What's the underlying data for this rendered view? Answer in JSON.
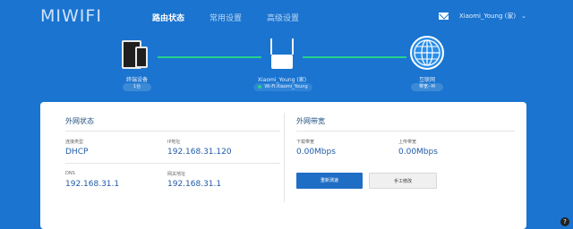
{
  "app": {
    "logo": "MIWIFI"
  },
  "nav": {
    "items": [
      {
        "label": "路由状态",
        "active": true
      },
      {
        "label": "常用设置",
        "active": false
      },
      {
        "label": "高级设置",
        "active": false
      }
    ]
  },
  "user": {
    "name": "Xiaomi_Young (家)",
    "mail_icon": "mail-icon",
    "chevron_icon": "chevron-down-icon"
  },
  "topology": {
    "devices": {
      "label": "终端设备",
      "count": "1台",
      "icon": "devices-icon"
    },
    "router": {
      "label": "Xiaomi_Young (家)",
      "wifi": "Wi-Fi:Xiaomi_Young",
      "icon": "router-icon"
    },
    "internet": {
      "label": "互联网",
      "status": "带宽--M",
      "icon": "globe-icon"
    },
    "link_color": "#25d38a"
  },
  "wan": {
    "title": "外网状态",
    "conn_type_label": "连接类型",
    "conn_type": "DHCP",
    "ip_label": "IP地址",
    "ip": "192.168.31.120",
    "dns_label": "DNS",
    "dns": "192.168.31.1",
    "gateway_label": "网关地址",
    "gateway": "192.168.31.1"
  },
  "bandwidth": {
    "title": "外网带宽",
    "down_label": "下载带宽",
    "down": "0.00Mbps",
    "up_label": "上传带宽",
    "up": "0.00Mbps",
    "retest_label": "重新测速",
    "manual_label": "手工修改"
  },
  "colors": {
    "background": "#1a74d0",
    "accent": "#1f6ec5",
    "value": "#1f5aa8"
  }
}
